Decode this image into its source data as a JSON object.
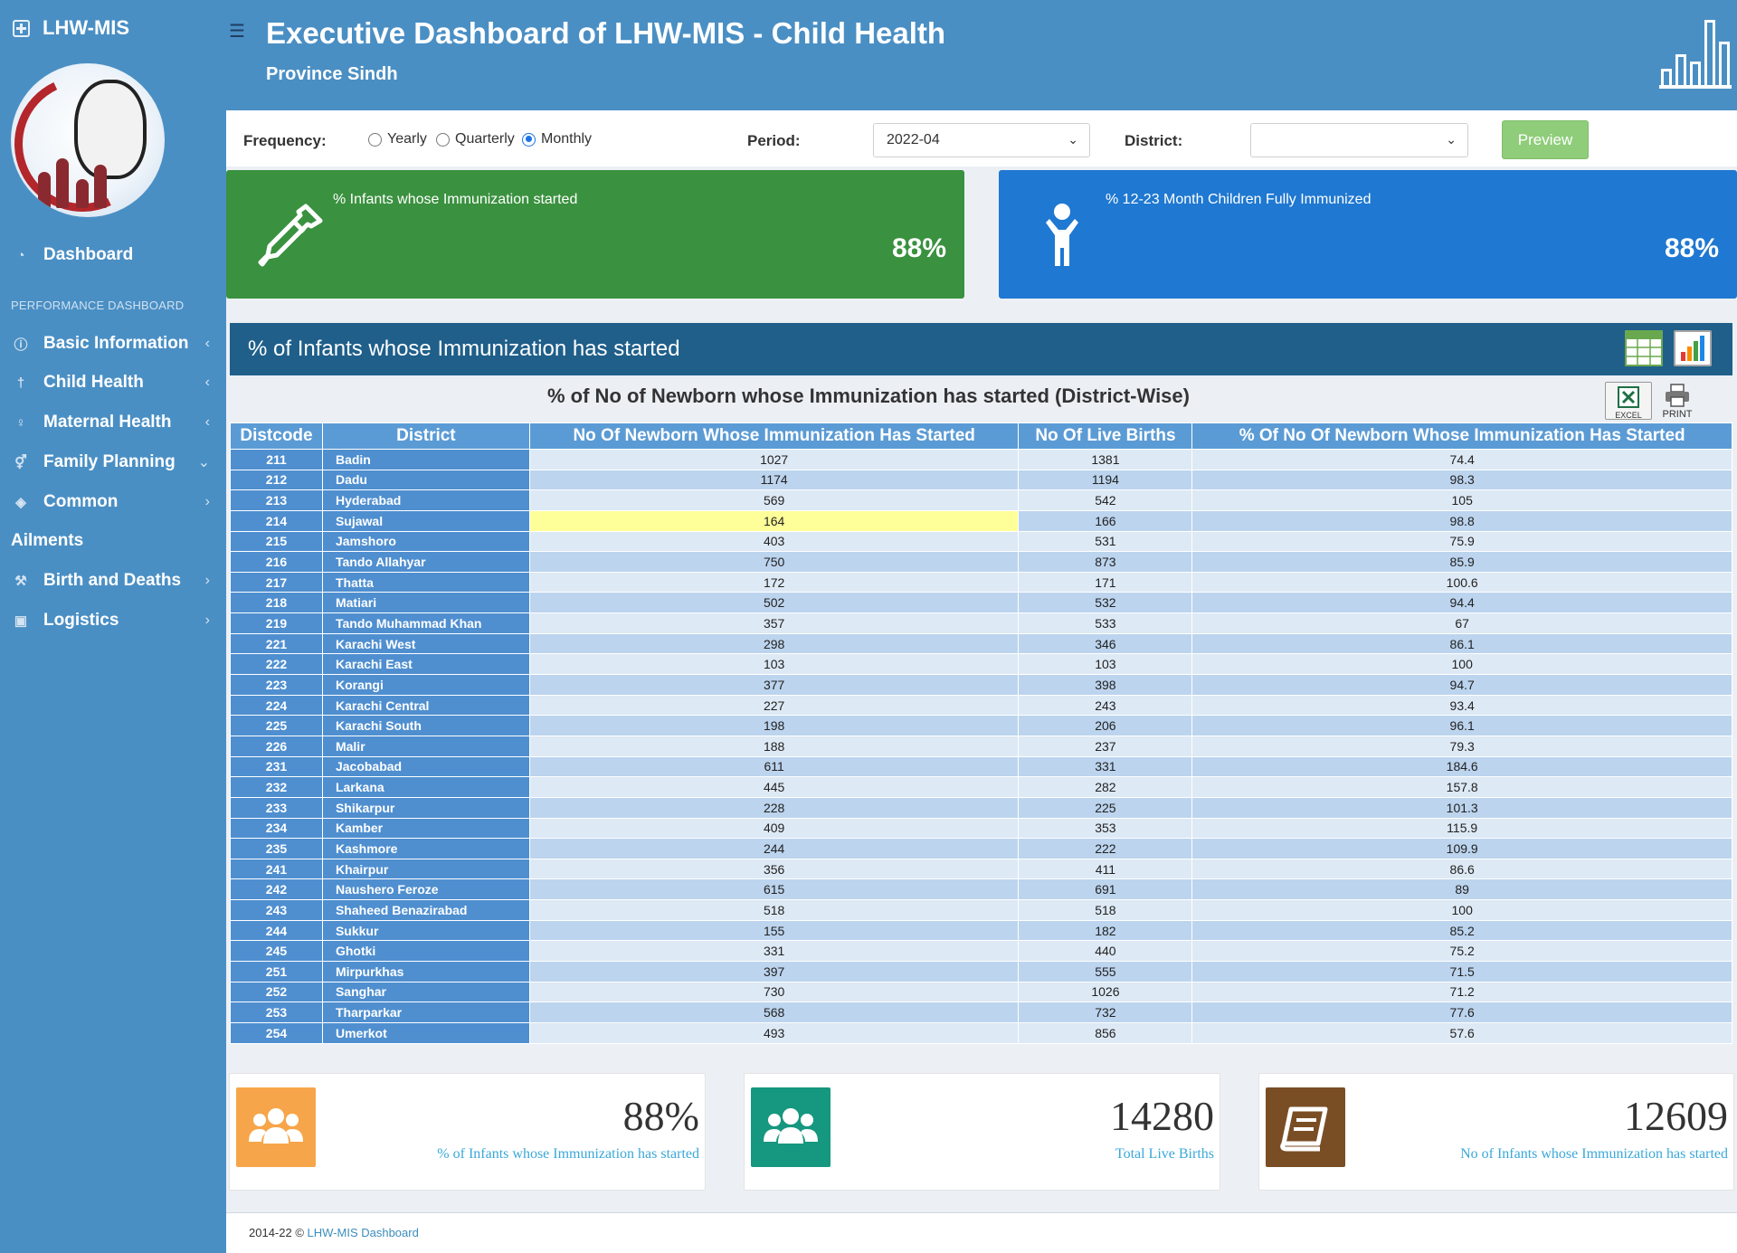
{
  "sidebar": {
    "brand": "LHW-MIS",
    "menu_header": "PERFORMANCE DASHBOARD",
    "items": [
      {
        "label": "Dashboard",
        "icon": "gauge-icon"
      },
      {
        "label": "Basic Information",
        "icon": "info-icon"
      },
      {
        "label": "Child Health",
        "icon": "child-icon"
      },
      {
        "label": "Maternal Health",
        "icon": "woman-icon"
      },
      {
        "label": "Family Planning",
        "icon": "gender-icon"
      },
      {
        "label": "Common",
        "icon": "pill-icon"
      },
      {
        "label": "Ailments",
        "icon": ""
      },
      {
        "label": "Birth and Deaths",
        "icon": "wrench-icon"
      },
      {
        "label": "Logistics",
        "icon": "briefcase-icon"
      }
    ]
  },
  "header": {
    "title": "Executive Dashboard of LHW-MIS - Child Health",
    "subtitle": "Province Sindh"
  },
  "filters": {
    "frequency_label": "Frequency:",
    "options": [
      "Yearly",
      "Quarterly",
      "Monthly"
    ],
    "selected": "Monthly",
    "period_label": "Period:",
    "period_value": "2022-04",
    "district_label": "District:",
    "district_value": "",
    "preview_label": "Preview"
  },
  "kpis": [
    {
      "label": "% Infants whose Immunization started",
      "value": "88%",
      "color": "#3a913f"
    },
    {
      "label": "% 12-23 Month Children Fully Immunized",
      "value": "88%",
      "color": "#1f78d1"
    }
  ],
  "panel": {
    "title": "% of Infants whose Immunization has started",
    "table_title": "% of No of Newborn whose Immunization has started (District-Wise)",
    "excel_label": "EXCEL",
    "print_label": "PRINT"
  },
  "table": {
    "headers": [
      "Distcode",
      "District",
      "No Of Newborn Whose Immunization Has Started",
      "No Of Live Births",
      "% Of No Of Newborn Whose Immunization Has Started"
    ],
    "rows": [
      [
        "211",
        "Badin",
        "1027",
        "1381",
        "74.4"
      ],
      [
        "212",
        "Dadu",
        "1174",
        "1194",
        "98.3"
      ],
      [
        "213",
        "Hyderabad",
        "569",
        "542",
        "105"
      ],
      [
        "214",
        "Sujawal",
        "164",
        "166",
        "98.8"
      ],
      [
        "215",
        "Jamshoro",
        "403",
        "531",
        "75.9"
      ],
      [
        "216",
        "Tando Allahyar",
        "750",
        "873",
        "85.9"
      ],
      [
        "217",
        "Thatta",
        "172",
        "171",
        "100.6"
      ],
      [
        "218",
        "Matiari",
        "502",
        "532",
        "94.4"
      ],
      [
        "219",
        "Tando Muhammad Khan",
        "357",
        "533",
        "67"
      ],
      [
        "221",
        "Karachi West",
        "298",
        "346",
        "86.1"
      ],
      [
        "222",
        "Karachi East",
        "103",
        "103",
        "100"
      ],
      [
        "223",
        "Korangi",
        "377",
        "398",
        "94.7"
      ],
      [
        "224",
        "Karachi Central",
        "227",
        "243",
        "93.4"
      ],
      [
        "225",
        "Karachi South",
        "198",
        "206",
        "96.1"
      ],
      [
        "226",
        "Malir",
        "188",
        "237",
        "79.3"
      ],
      [
        "231",
        "Jacobabad",
        "611",
        "331",
        "184.6"
      ],
      [
        "232",
        "Larkana",
        "445",
        "282",
        "157.8"
      ],
      [
        "233",
        "Shikarpur",
        "228",
        "225",
        "101.3"
      ],
      [
        "234",
        "Kamber",
        "409",
        "353",
        "115.9"
      ],
      [
        "235",
        "Kashmore",
        "244",
        "222",
        "109.9"
      ],
      [
        "241",
        "Khairpur",
        "356",
        "411",
        "86.6"
      ],
      [
        "242",
        "Naushero Feroze",
        "615",
        "691",
        "89"
      ],
      [
        "243",
        "Shaheed Benazirabad",
        "518",
        "518",
        "100"
      ],
      [
        "244",
        "Sukkur",
        "155",
        "182",
        "85.2"
      ],
      [
        "245",
        "Ghotki",
        "331",
        "440",
        "75.2"
      ],
      [
        "251",
        "Mirpurkhas",
        "397",
        "555",
        "71.5"
      ],
      [
        "252",
        "Sanghar",
        "730",
        "1026",
        "71.2"
      ],
      [
        "253",
        "Tharparkar",
        "568",
        "732",
        "77.6"
      ],
      [
        "254",
        "Umerkot",
        "493",
        "856",
        "57.6"
      ]
    ],
    "highlight_row": 3
  },
  "info_boxes": [
    {
      "value": "88%",
      "label": "% of Infants whose Immunization has started",
      "color": "#f7a54a",
      "icon": "users-icon"
    },
    {
      "value": "14280",
      "label": "Total Live Births",
      "color": "#16977f",
      "icon": "users-icon"
    },
    {
      "value": "12609",
      "label": "No of Infants whose Immunization has started",
      "color": "#7a4e25",
      "icon": "book-icon"
    }
  ],
  "footer": {
    "text": "2014-22 © ",
    "link": "LHW-MIS Dashboard"
  }
}
